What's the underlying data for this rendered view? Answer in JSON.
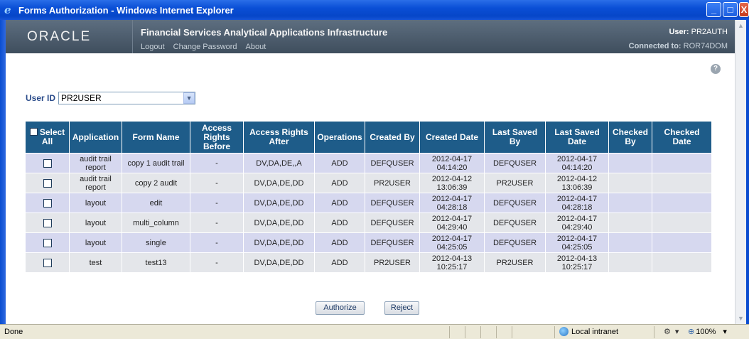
{
  "window": {
    "title": "Forms Authorization - Windows Internet Explorer",
    "controls": {
      "minimize": "_",
      "maximize": "□",
      "close": "X"
    }
  },
  "header": {
    "logo": "ORACLE",
    "app_title": "Financial Services Analytical Applications Infrastructure",
    "links": [
      "Logout",
      "Change Password",
      "About"
    ],
    "user_label": "User:",
    "user_value": "PR2AUTH",
    "connected_label": "Connected to:",
    "connected_value": "ROR74DOM"
  },
  "help_icon": "?",
  "filter": {
    "label": "User ID",
    "selected": "PR2USER"
  },
  "table": {
    "select_all_label": "Select All",
    "columns": [
      "Application",
      "Form Name",
      "Access Rights Before",
      "Access Rights After",
      "Operations",
      "Created By",
      "Created Date",
      "Last Saved By",
      "Last Saved Date",
      "Checked By",
      "Checked Date"
    ],
    "rows": [
      {
        "application": "audit trail report",
        "form_name": "copy 1 audit trail",
        "before": "-",
        "after": "DV,DA,DE,,A",
        "operation": "ADD",
        "created_by": "DEFQUSER",
        "created_date": "2012-04-17 04:14:20",
        "saved_by": "DEFQUSER",
        "saved_date": "2012-04-17 04:14:20",
        "checked_by": "",
        "checked_date": ""
      },
      {
        "application": "audit trail report",
        "form_name": "copy 2 audit",
        "before": "-",
        "after": "DV,DA,DE,DD",
        "operation": "ADD",
        "created_by": "PR2USER",
        "created_date": "2012-04-12 13:06:39",
        "saved_by": "PR2USER",
        "saved_date": "2012-04-12 13:06:39",
        "checked_by": "",
        "checked_date": ""
      },
      {
        "application": "layout",
        "form_name": "edit",
        "before": "-",
        "after": "DV,DA,DE,DD",
        "operation": "ADD",
        "created_by": "DEFQUSER",
        "created_date": "2012-04-17 04:28:18",
        "saved_by": "DEFQUSER",
        "saved_date": "2012-04-17 04:28:18",
        "checked_by": "",
        "checked_date": ""
      },
      {
        "application": "layout",
        "form_name": "multi_column",
        "before": "-",
        "after": "DV,DA,DE,DD",
        "operation": "ADD",
        "created_by": "DEFQUSER",
        "created_date": "2012-04-17 04:29:40",
        "saved_by": "DEFQUSER",
        "saved_date": "2012-04-17 04:29:40",
        "checked_by": "",
        "checked_date": ""
      },
      {
        "application": "layout",
        "form_name": "single",
        "before": "-",
        "after": "DV,DA,DE,DD",
        "operation": "ADD",
        "created_by": "DEFQUSER",
        "created_date": "2012-04-17 04:25:05",
        "saved_by": "DEFQUSER",
        "saved_date": "2012-04-17 04:25:05",
        "checked_by": "",
        "checked_date": ""
      },
      {
        "application": "test",
        "form_name": "test13",
        "before": "-",
        "after": "DV,DA,DE,DD",
        "operation": "ADD",
        "created_by": "PR2USER",
        "created_date": "2012-04-13 10:25:17",
        "saved_by": "PR2USER",
        "saved_date": "2012-04-13 10:25:17",
        "checked_by": "",
        "checked_date": ""
      }
    ]
  },
  "buttons": {
    "authorize": "Authorize",
    "reject": "Reject"
  },
  "statusbar": {
    "status": "Done",
    "zone": "Local intranet",
    "zoom": "100%"
  }
}
